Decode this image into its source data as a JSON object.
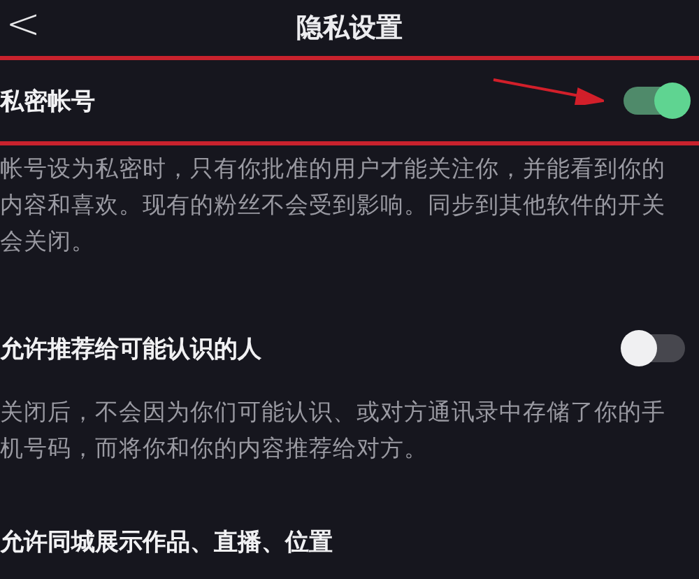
{
  "header": {
    "back": "<",
    "title": "隐私设置"
  },
  "settings": [
    {
      "title": "私密帐号",
      "on": true,
      "highlighted": true,
      "pointer_arrow": true,
      "description": "帐号设为私密时，只有你批准的用户才能关注你，并能看到你的内容和喜欢。现有的粉丝不会受到影响。同步到其他软件的开关会关闭。"
    },
    {
      "title": "允许推荐给可能认识的人",
      "on": false,
      "description": "关闭后，不会因为你们可能认识、或对方通讯录中存储了你的手机号码，而将你和你的内容推荐给对方。"
    },
    {
      "title": "允许同城展示作品、直播、位置"
    }
  ]
}
